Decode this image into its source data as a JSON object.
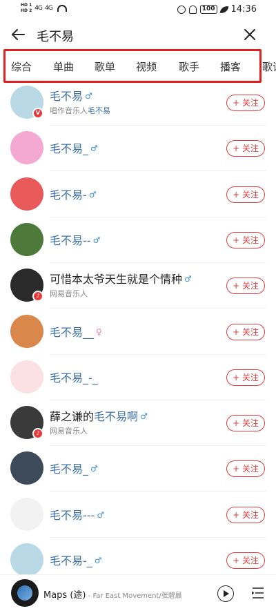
{
  "status_bar": {
    "hd1": "HD 1",
    "hd2": "HD 2",
    "signal1": "4G",
    "signal2": "4G",
    "battery": "100",
    "time": "14:36"
  },
  "search": {
    "query": "毛不易"
  },
  "tabs": [
    "综合",
    "单曲",
    "歌单",
    "视频",
    "歌手",
    "播客",
    "歌词"
  ],
  "follow_label": "+ 关注",
  "users": [
    {
      "name_pre": "",
      "name_hl": "毛不易",
      "name_post": "",
      "gender": "♂",
      "sub_pre": "唱作音乐人",
      "sub_hl": "毛不易",
      "badge": "V",
      "avatar_bg": "#b9d9e6"
    },
    {
      "name_pre": "",
      "name_hl": "毛不易",
      "name_post": "_",
      "gender": "♂",
      "sub_pre": "",
      "sub_hl": "",
      "badge": "",
      "avatar_bg": "#f3a9d1"
    },
    {
      "name_pre": "",
      "name_hl": "毛不易",
      "name_post": "-",
      "gender": "♂",
      "sub_pre": "",
      "sub_hl": "",
      "badge": "",
      "avatar_bg": "#e85a5a"
    },
    {
      "name_pre": "",
      "name_hl": "毛不易",
      "name_post": "--",
      "gender": "♂",
      "sub_pre": "",
      "sub_hl": "",
      "badge": "",
      "avatar_bg": "#4d7a3a"
    },
    {
      "name_pre": "可惜本太爷天生就是个情种",
      "name_hl": "",
      "name_post": "",
      "gender": "♂",
      "sub_pre": "网易音乐人",
      "sub_hl": "",
      "badge": "♪",
      "avatar_bg": "#2a2a2a"
    },
    {
      "name_pre": "",
      "name_hl": "毛不易",
      "name_post": "__",
      "gender": "♀",
      "sub_pre": "",
      "sub_hl": "",
      "badge": "",
      "avatar_bg": "#d9874a"
    },
    {
      "name_pre": "",
      "name_hl": "毛不易",
      "name_post": "_-_",
      "gender": "",
      "sub_pre": "",
      "sub_hl": "",
      "badge": "",
      "avatar_bg": "#fbe1e4"
    },
    {
      "name_pre": "薛之谦的",
      "name_hl": "毛不易",
      "name_post": "啊",
      "gender": "♂",
      "sub_pre": "网易音乐人",
      "sub_hl": "",
      "badge": "♪",
      "avatar_bg": "#3a3a3a"
    },
    {
      "name_pre": "",
      "name_hl": "毛不易",
      "name_post": "_",
      "gender": "♂",
      "sub_pre": "",
      "sub_hl": "",
      "badge": "",
      "avatar_bg": "#3d4a5a"
    },
    {
      "name_pre": "",
      "name_hl": "毛不易",
      "name_post": "---",
      "gender": "♂",
      "sub_pre": "",
      "sub_hl": "",
      "badge": "",
      "avatar_bg": "#f2f2f2"
    },
    {
      "name_pre": "",
      "name_hl": "毛不易",
      "name_post": "-_",
      "gender": "♂",
      "sub_pre": "",
      "sub_hl": "",
      "badge": "",
      "avatar_bg": "#b9d9e6"
    }
  ],
  "player": {
    "song": "Maps (途)",
    "artist": " - Far East Movement/张碧晨"
  },
  "colors": {
    "accent": "#e03c3c",
    "highlight_text": "#3c6fa6",
    "male": "#3b8fd9",
    "female": "#e77bb0"
  }
}
